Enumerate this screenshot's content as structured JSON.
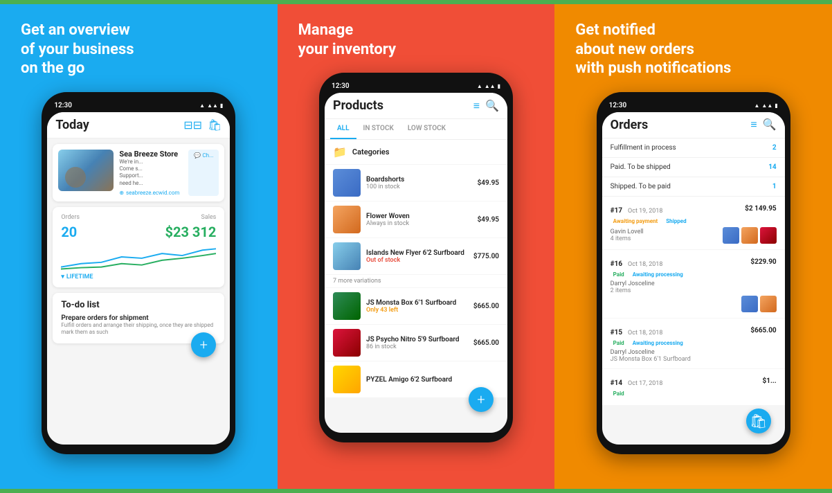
{
  "panels": [
    {
      "id": "panel-blue",
      "bg": "#1AABF0",
      "headline": "Get an overview\nof your business\non the go",
      "phone": {
        "time": "12:30",
        "screen": {
          "title": "Today",
          "store": {
            "name": "Sea Breeze Store",
            "description": "We're in...\nCome s...\nSupport...\nneed he...",
            "url": "seabreeze.ecwid.com",
            "chat": "Ch..."
          },
          "stats": {
            "orders_label": "Orders",
            "sales_label": "Sales",
            "orders_value": "20",
            "sales_value": "$23 312",
            "period": "LIFETIME"
          },
          "todo": {
            "title": "To-do list",
            "item_title": "Prepare orders for shipment",
            "item_desc": "Fulfill orders and arrange their shipping, once they are shipped mark them as such"
          }
        }
      }
    },
    {
      "id": "panel-red",
      "bg": "#F04E37",
      "headline": "Manage\nyour inventory",
      "phone": {
        "time": "12:30",
        "screen": {
          "title": "Products",
          "tabs": [
            "ALL",
            "IN STOCK",
            "LOW STOCK"
          ],
          "active_tab": "ALL",
          "category": "Categories",
          "products": [
            {
              "name": "Boardshorts",
              "stock": "100 in stock",
              "stock_type": "normal",
              "price": "$49.95"
            },
            {
              "name": "Flower Woven",
              "stock": "Always in stock",
              "stock_type": "normal",
              "price": "$49.95"
            },
            {
              "name": "Islands New Flyer 6'2 Surfboard",
              "stock": "Out of stock",
              "stock_type": "out",
              "price": "$775.00",
              "note": "7 more variations"
            },
            {
              "name": "JS Monsta Box 6'1 Surfboard",
              "stock": "Only 43 left",
              "stock_type": "low",
              "price": "$665.00"
            },
            {
              "name": "JS Psycho Nitro 5'9 Surfboard",
              "stock": "86 in stock",
              "stock_type": "normal",
              "price": "$665.00"
            },
            {
              "name": "PYZEL Amigo 6'2 Surfboard",
              "stock": "",
              "stock_type": "normal",
              "price": ""
            }
          ]
        }
      }
    },
    {
      "id": "panel-orange",
      "bg": "#F08A00",
      "headline": "Get notified\nabout new orders\nwith push notifications",
      "phone": {
        "time": "12:30",
        "screen": {
          "title": "Orders",
          "fulfillment_sections": [
            {
              "label": "Fulfillment in process",
              "count": "2"
            },
            {
              "label": "Paid. To be shipped",
              "count": "14"
            },
            {
              "label": "Shipped. To be paid",
              "count": "1"
            }
          ],
          "orders": [
            {
              "id": "#17",
              "date": "Oct 19, 2018",
              "price": "$2 149.95",
              "tags": [
                "Awaiting payment",
                "Shipped"
              ],
              "tag_colors": [
                "tag-orange",
                "tag-blue"
              ],
              "customer": "Gavin Lovell",
              "items": "4 items"
            },
            {
              "id": "#16",
              "date": "Oct 18, 2018",
              "price": "$229.90",
              "tags": [
                "Paid",
                "Awaiting processing"
              ],
              "tag_colors": [
                "tag-green",
                "tag-blue"
              ],
              "customer": "Darryl Josceline",
              "items": "2 items"
            },
            {
              "id": "#15",
              "date": "Oct 18, 2018",
              "price": "$665.00",
              "tags": [
                "Paid",
                "Awaiting processing"
              ],
              "tag_colors": [
                "tag-green",
                "tag-blue"
              ],
              "customer": "Darryl Josceline",
              "items": "JS Monsta Box 6'1 Surfboard"
            },
            {
              "id": "#14",
              "date": "Oct 17, 2018",
              "price": "$1...",
              "tags": [
                "Paid"
              ],
              "tag_colors": [
                "tag-green"
              ],
              "customer": "",
              "items": ""
            }
          ]
        }
      }
    }
  ]
}
